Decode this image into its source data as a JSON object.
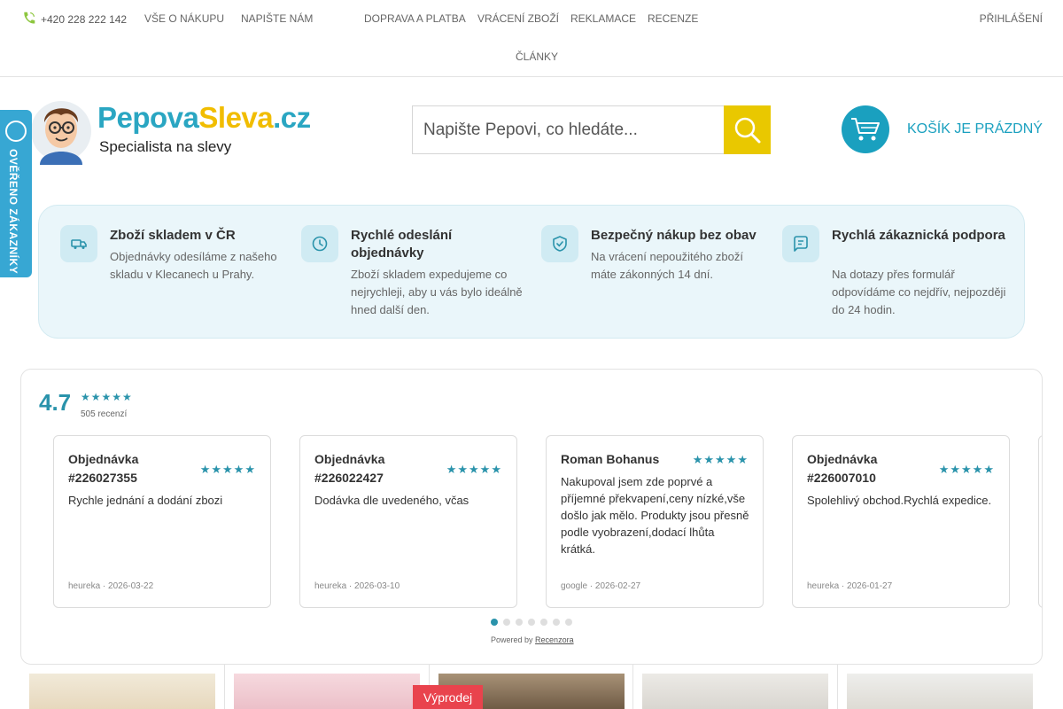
{
  "topbar": {
    "phone": "+420 228 222 142",
    "links": [
      "VŠE O NÁKUPU",
      "NAPIŠTE NÁM",
      "DOPRAVA A PLATBA",
      "VRÁCENÍ ZBOŽÍ",
      "REKLAMACE",
      "RECENZE",
      "ČLÁNKY"
    ],
    "login": "PŘIHLÁŠENÍ"
  },
  "logo": {
    "brand_part1": "Pepova",
    "brand_part2": "Sleva",
    "brand_part3": ".cz",
    "tagline": "Specialista na slevy"
  },
  "search": {
    "placeholder": "Napište Pepovi, co hledáte..."
  },
  "cart": {
    "label": "KOŠÍK JE PRÁZDNÝ"
  },
  "verified_badge": {
    "label": "OVĚŘENO ZÁKAZNÍKY"
  },
  "benefits": [
    {
      "icon": "truck-icon",
      "title": "Zboží skladem v ČR",
      "desc": "Objednávky odesíláme z našeho skladu v Klecanech u Prahy."
    },
    {
      "icon": "clock-icon",
      "title": "Rychlé odeslání objednávky",
      "desc": "Zboží skladem expedujeme co nejrychleji, aby u vás bylo ideálně hned další den."
    },
    {
      "icon": "shield-check-icon",
      "title": "Bezpečný nákup bez obav",
      "desc": "Na vrácení nepoužitého zboží máte zákonných 14 dní."
    },
    {
      "icon": "chat-icon",
      "title": "Rychlá zákaznická podpora",
      "desc": "Na dotazy přes formulář odpovídáme co nejdřív, nejpozději do 24 hodin."
    }
  ],
  "reviews": {
    "rating": "4.7",
    "stars": "★★★★★",
    "count": "505 recenzí",
    "items": [
      {
        "title": "Objednávka #226027355",
        "stars": "★★★★★",
        "text": "Rychle jednání a dodání zbozi",
        "footer": "heureka · 2026-03-22"
      },
      {
        "title": "Objednávka #226022427",
        "stars": "★★★★★",
        "text": "Dodávka dle uvedeného, včas",
        "footer": "heureka · 2026-03-10"
      },
      {
        "title": "Roman Bohanus",
        "stars": "★★★★★",
        "text": "Nakupoval jsem zde poprvé a příjemné překvapení,ceny nízké,vše došlo jak mělo. Produkty jsou přesně podle vyobrazení,dodací lhůta krátká.",
        "footer": "google · 2026-02-27"
      },
      {
        "title": "Objednávka #226007010",
        "stars": "★★★★★",
        "text": "Spolehlivý obchod.Rychlá expedice.",
        "footer": "heureka · 2026-01-27"
      }
    ],
    "powered_prefix": "Powered by",
    "powered_link": "Recenzora"
  },
  "products": {
    "sale_badge": "Výprodej"
  },
  "colors": {
    "accent": "#2aa6c2",
    "brand_yellow": "#f1bd00",
    "search_button": "#e9c800",
    "sale": "#e9434d"
  }
}
